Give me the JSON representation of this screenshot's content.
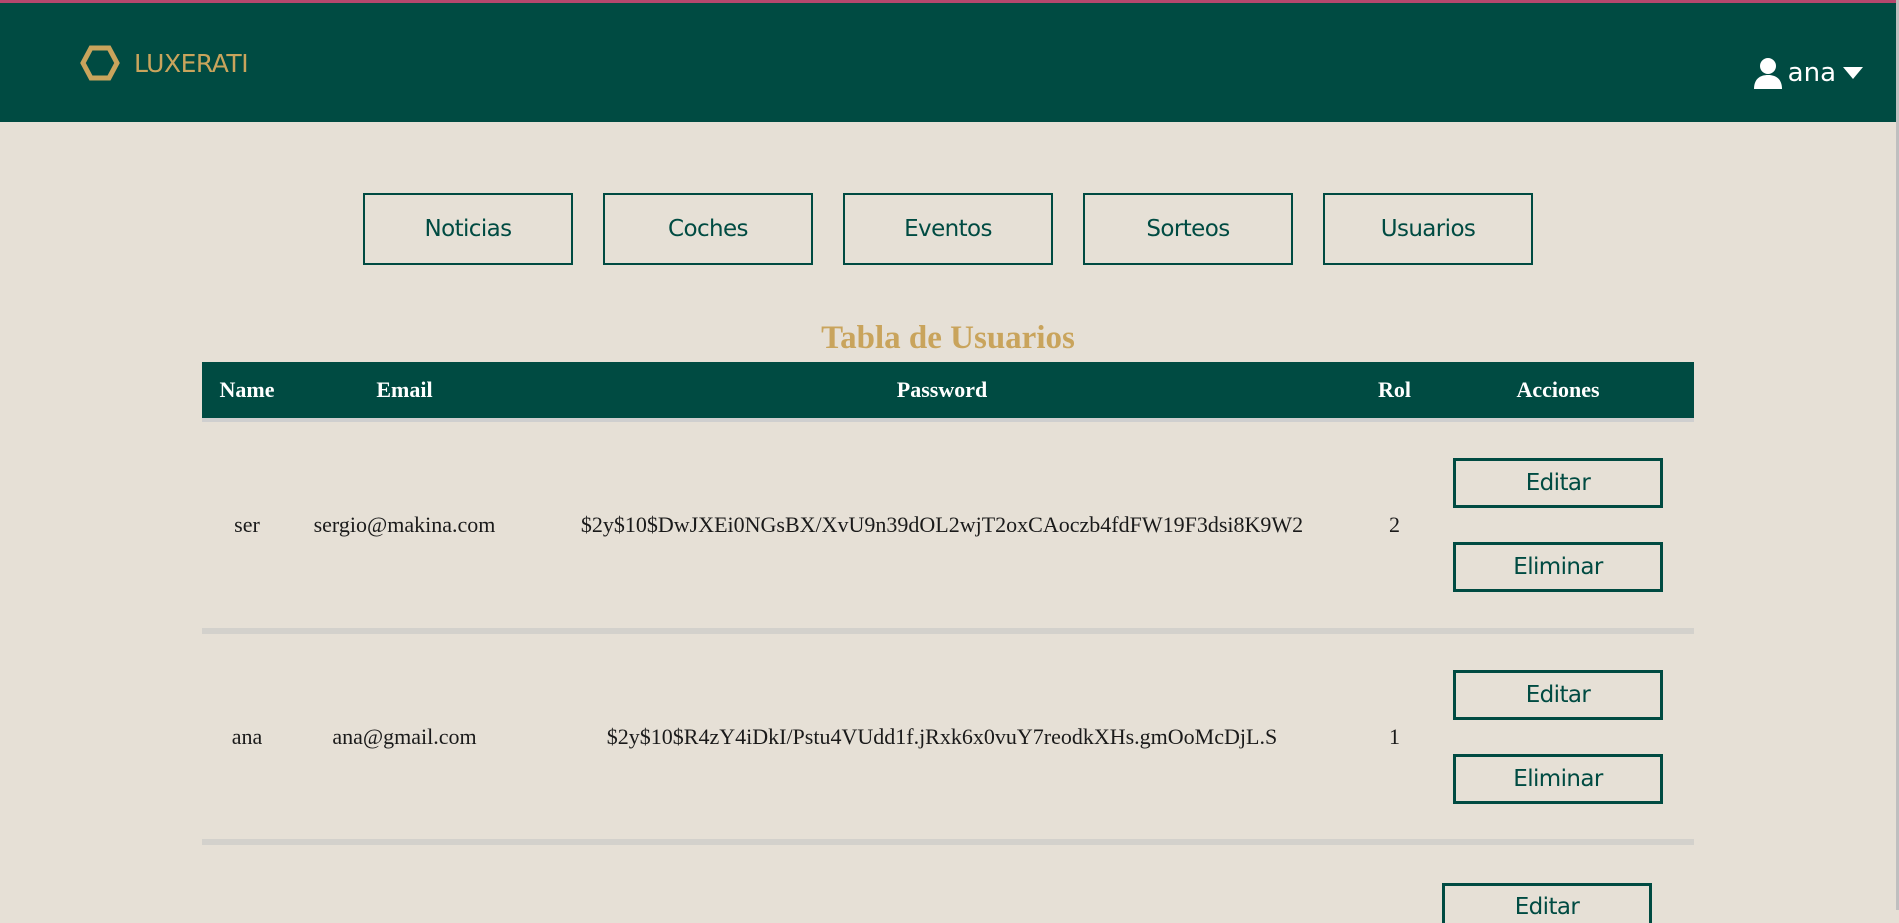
{
  "header": {
    "brand": "LUXERATI",
    "user": "ana"
  },
  "tabs": [
    {
      "label": "Noticias"
    },
    {
      "label": "Coches"
    },
    {
      "label": "Eventos"
    },
    {
      "label": "Sorteos"
    },
    {
      "label": "Usuarios"
    }
  ],
  "table": {
    "title": "Tabla de Usuarios",
    "columns": [
      "Name",
      "Email",
      "Password",
      "Rol",
      "Acciones"
    ],
    "rows": [
      {
        "name": "ser",
        "email": "sergio@makina.com",
        "password": "$2y$10$DwJXEi0NGsBX/XvU9n39dOL2wjT2oxCAoczb4fdFW19F3dsi8K9W2",
        "rol": "2",
        "edit": "Editar",
        "delete": "Eliminar"
      },
      {
        "name": "ana",
        "email": "ana@gmail.com",
        "password": "$2y$10$R4zY4iDkI/Pstu4VUdd1f.jRxk6x0vuY7reodkXHs.gmOoMcDjL.S",
        "rol": "1",
        "edit": "Editar",
        "delete": "Eliminar"
      }
    ],
    "partial_next_button": "Editar"
  },
  "colors": {
    "primary": "#004b42",
    "accent": "#c9a45c",
    "background": "#e6e0d6"
  }
}
